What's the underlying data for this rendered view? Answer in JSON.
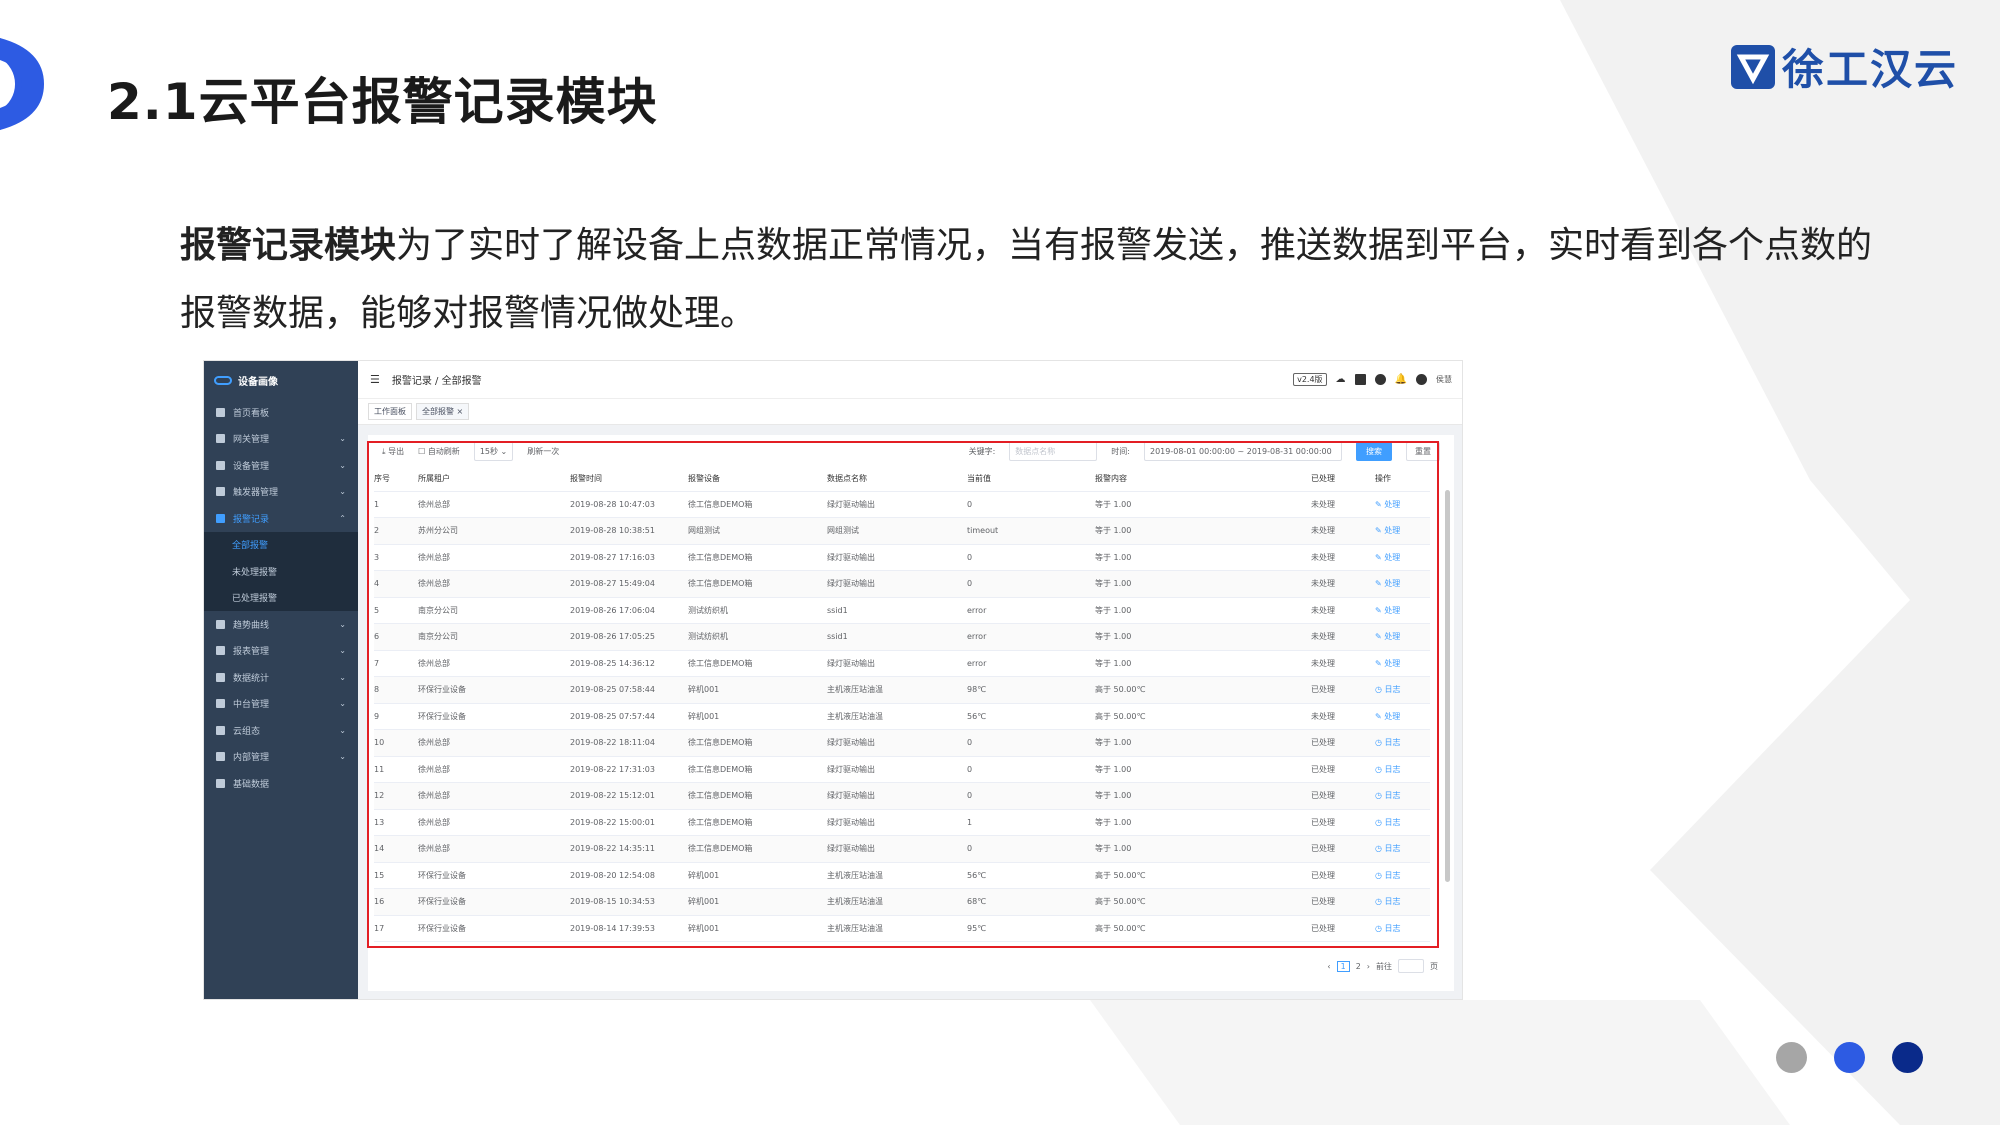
{
  "slide": {
    "title": "2.1云平台报警记录模块",
    "brand": "徐工汉云",
    "intro_bold": "报警记录模块",
    "intro_rest": "为了实时了解设备上点数据正常情况，当有报警发送，推送数据到平台，实时看到各个点数的报警数据，能够对报警情况做处理。",
    "colors": {
      "accent": "#2d5be3",
      "dark": "#0a2a8a",
      "gray": "#a6a6a6",
      "highlight": "#e31e24"
    }
  },
  "app": {
    "sidebar": {
      "brand": "设备画像",
      "items": [
        {
          "label": "首页看板",
          "icon": "dashboard-icon"
        },
        {
          "label": "网关管理",
          "icon": "gateway-icon"
        },
        {
          "label": "设备管理",
          "icon": "device-icon"
        },
        {
          "label": "触发器管理",
          "icon": "trigger-icon"
        },
        {
          "label": "报警记录",
          "icon": "alarm-icon",
          "active": true
        },
        {
          "label": "趋势曲线",
          "icon": "trend-icon"
        },
        {
          "label": "报表管理",
          "icon": "report-icon"
        },
        {
          "label": "数据统计",
          "icon": "stats-icon"
        },
        {
          "label": "中台管理",
          "icon": "platform-icon"
        },
        {
          "label": "云组态",
          "icon": "cloud-icon"
        },
        {
          "label": "内部管理",
          "icon": "internal-icon"
        },
        {
          "label": "基础数据",
          "icon": "data-icon"
        }
      ],
      "sub_items": [
        "全部报警",
        "未处理报警",
        "已处理报警"
      ]
    },
    "topbar": {
      "breadcrumb": "报警记录 / 全部报警",
      "version": "v2.4版",
      "user": "侯慧"
    },
    "tabs": [
      "工作面板",
      "全部报警 ×"
    ],
    "toolbar": {
      "export": "导出",
      "auto_refresh": "自动刷新",
      "interval": "15秒",
      "refresh_once": "刷新一次",
      "keyword_label": "关键字:",
      "keyword_placeholder": "数据点名称",
      "time_label": "时间:",
      "time_range": "2019-08-01 00:00:00  ~  2019-08-31 00:00:00",
      "search": "搜索",
      "reset": "重置"
    },
    "table": {
      "columns": [
        "序号",
        "所属租户",
        "报警时间",
        "报警设备",
        "数据点名称",
        "当前值",
        "报警内容",
        "已处理",
        "操作"
      ],
      "rows": [
        [
          "1",
          "徐州总部",
          "2019-08-28 10:47:03",
          "徐工信息DEMO箱",
          "绿灯驱动输出",
          "0",
          "等于 1.00",
          "未处理",
          "处理"
        ],
        [
          "2",
          "苏州分公司",
          "2019-08-28 10:38:51",
          "网组测试",
          "网组测试",
          "timeout",
          "等于 1.00",
          "未处理",
          "处理"
        ],
        [
          "3",
          "徐州总部",
          "2019-08-27 17:16:03",
          "徐工信息DEMO箱",
          "绿灯驱动输出",
          "0",
          "等于 1.00",
          "未处理",
          "处理"
        ],
        [
          "4",
          "徐州总部",
          "2019-08-27 15:49:04",
          "徐工信息DEMO箱",
          "绿灯驱动输出",
          "0",
          "等于 1.00",
          "未处理",
          "处理"
        ],
        [
          "5",
          "南京分公司",
          "2019-08-26 17:06:04",
          "测试纺织机",
          "ssid1",
          "error",
          "等于 1.00",
          "未处理",
          "处理"
        ],
        [
          "6",
          "南京分公司",
          "2019-08-26 17:05:25",
          "测试纺织机",
          "ssid1",
          "error",
          "等于 1.00",
          "未处理",
          "处理"
        ],
        [
          "7",
          "徐州总部",
          "2019-08-25 14:36:12",
          "徐工信息DEMO箱",
          "绿灯驱动输出",
          "error",
          "等于 1.00",
          "未处理",
          "处理"
        ],
        [
          "8",
          "环保行业设备",
          "2019-08-25 07:58:44",
          "碎机001",
          "主机液压站油温",
          "98℃",
          "高于 50.00℃",
          "已处理",
          "日志"
        ],
        [
          "9",
          "环保行业设备",
          "2019-08-25 07:57:44",
          "碎机001",
          "主机液压站油温",
          "56℃",
          "高于 50.00℃",
          "未处理",
          "处理"
        ],
        [
          "10",
          "徐州总部",
          "2019-08-22 18:11:04",
          "徐工信息DEMO箱",
          "绿灯驱动输出",
          "0",
          "等于 1.00",
          "已处理",
          "日志"
        ],
        [
          "11",
          "徐州总部",
          "2019-08-22 17:31:03",
          "徐工信息DEMO箱",
          "绿灯驱动输出",
          "0",
          "等于 1.00",
          "已处理",
          "日志"
        ],
        [
          "12",
          "徐州总部",
          "2019-08-22 15:12:01",
          "徐工信息DEMO箱",
          "绿灯驱动输出",
          "0",
          "等于 1.00",
          "已处理",
          "日志"
        ],
        [
          "13",
          "徐州总部",
          "2019-08-22 15:00:01",
          "徐工信息DEMO箱",
          "绿灯驱动输出",
          "1",
          "等于 1.00",
          "已处理",
          "日志"
        ],
        [
          "14",
          "徐州总部",
          "2019-08-22 14:35:11",
          "徐工信息DEMO箱",
          "绿灯驱动输出",
          "0",
          "等于 1.00",
          "已处理",
          "日志"
        ],
        [
          "15",
          "环保行业设备",
          "2019-08-20 12:54:08",
          "碎机001",
          "主机液压站油温",
          "56℃",
          "高于 50.00℃",
          "已处理",
          "日志"
        ],
        [
          "16",
          "环保行业设备",
          "2019-08-15 10:34:53",
          "碎机001",
          "主机液压站油温",
          "68℃",
          "高于 50.00℃",
          "已处理",
          "日志"
        ],
        [
          "17",
          "环保行业设备",
          "2019-08-14 17:39:53",
          "碎机001",
          "主机液压站油温",
          "95℃",
          "高于 50.00℃",
          "已处理",
          "日志"
        ]
      ]
    },
    "pagination": {
      "pages": [
        "1",
        "2"
      ],
      "goto": "前往",
      "unit": "页"
    }
  }
}
